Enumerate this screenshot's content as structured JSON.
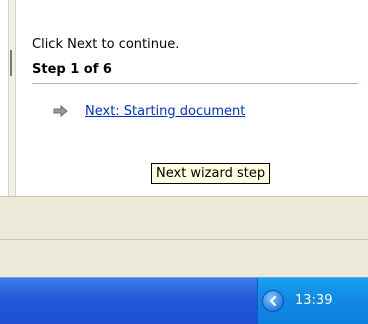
{
  "task_pane": {
    "intro_text": "Click Next to continue.",
    "step_heading": "Step 1 of 6",
    "next_link": "Next: Starting document"
  },
  "tooltip": {
    "text": "Next wizard step"
  },
  "taskbar": {
    "clock": "13:39",
    "tray_expand_icon": "chevron-left-icon"
  },
  "colors": {
    "link": "#0033cc",
    "tooltip_bg": "#ffffe1",
    "taskbar_blue": "#2458d9",
    "tray_blue": "#0f8ae4"
  }
}
